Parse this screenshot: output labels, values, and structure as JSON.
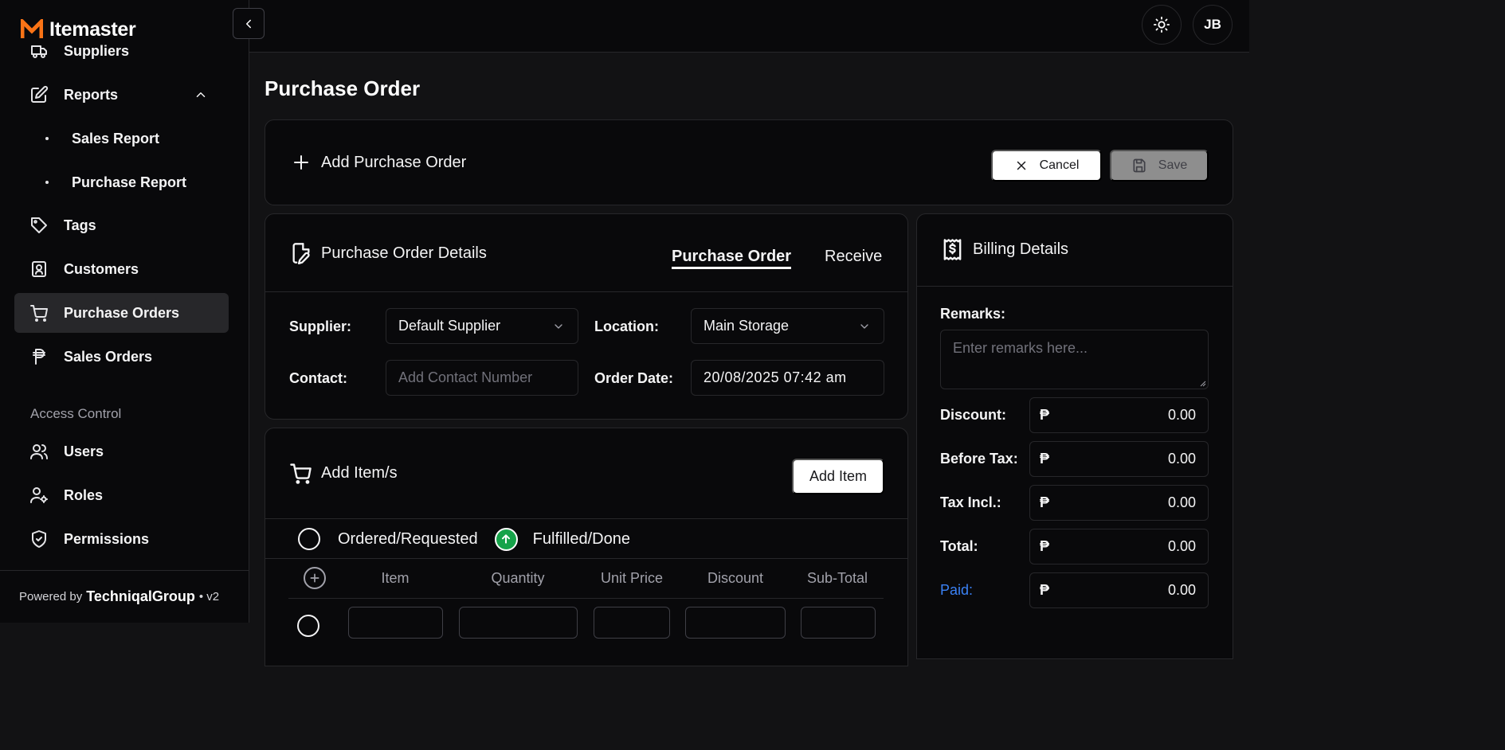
{
  "brand": {
    "name": "Itemaster",
    "accent": "#f97316"
  },
  "sidebar": {
    "partial_item": "Suppliers",
    "reports_label": "Reports",
    "sub_items": [
      "Sales Report",
      "Purchase Report"
    ],
    "items": {
      "tags": "Tags",
      "customers": "Customers",
      "purchase_orders": "Purchase Orders",
      "sales_orders": "Sales Orders"
    },
    "access_control_label": "Access Control",
    "access_items": {
      "users": "Users",
      "roles": "Roles",
      "permissions": "Permissions"
    },
    "footer": {
      "prefix": "Powered by",
      "brand": "TechniqalGroup",
      "version": "• v2"
    }
  },
  "topbar": {
    "avatar_initials": "JB"
  },
  "page": {
    "title": "Purchase Order"
  },
  "action_bar": {
    "title": "Add Purchase Order",
    "cancel": "Cancel",
    "save": "Save"
  },
  "details": {
    "title": "Purchase Order Details",
    "tabs": {
      "purchase_order": "Purchase Order",
      "receive": "Receive"
    },
    "supplier_label": "Supplier:",
    "supplier_value": "Default Supplier",
    "location_label": "Location:",
    "location_value": "Main Storage",
    "contact_label": "Contact:",
    "contact_placeholder": "Add Contact Number",
    "order_date_label": "Order Date:",
    "order_date_value": "20/08/2025 07:42 am"
  },
  "items_section": {
    "title": "Add Item/s",
    "add_button": "Add Item",
    "legend": {
      "ordered": "Ordered/Requested",
      "fulfilled": "Fulfilled/Done",
      "fulfilled_color": "#16a34a"
    },
    "columns": {
      "item": "Item",
      "quantity": "Quantity",
      "unit_price": "Unit Price",
      "discount": "Discount",
      "subtotal": "Sub-Total"
    }
  },
  "billing": {
    "title": "Billing Details",
    "remarks_label": "Remarks:",
    "remarks_placeholder": "Enter remarks here...",
    "currency": "₱",
    "rows": {
      "discount": {
        "label": "Discount:",
        "value": "0.00"
      },
      "before_tax": {
        "label": "Before Tax:",
        "value": "0.00"
      },
      "tax_incl": {
        "label": "Tax Incl.:",
        "value": "0.00"
      },
      "total": {
        "label": "Total:",
        "value": "0.00"
      },
      "paid": {
        "label": "Paid:",
        "value": "0.00",
        "color": "#3b82f6"
      }
    }
  }
}
